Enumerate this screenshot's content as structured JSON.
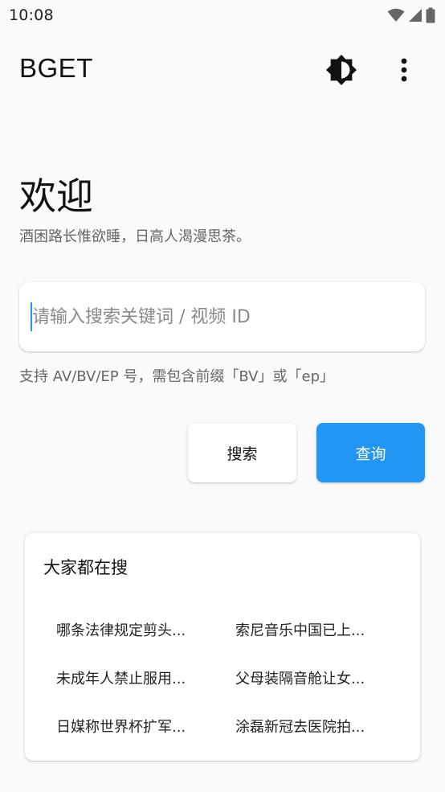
{
  "status_bar": {
    "time": "10:08"
  },
  "app_bar": {
    "title": "BGET"
  },
  "welcome": {
    "title": "欢迎",
    "subtitle": "酒困路长惟欲睡，日高人渴漫思茶。"
  },
  "search": {
    "placeholder": "请输入搜索关键词 / 视频 ID",
    "value": "",
    "helper": "支持 AV/BV/EP 号，需包含前缀「BV」或「ep」"
  },
  "buttons": {
    "search_label": "搜索",
    "query_label": "查询"
  },
  "trending": {
    "title": "大家都在搜",
    "items": [
      {
        "label": "哪条法律规定剪头..."
      },
      {
        "label": "索尼音乐中国已上..."
      },
      {
        "label": "未成年人禁止服用..."
      },
      {
        "label": "父母装隔音舱让女..."
      },
      {
        "label": "日媒称世界杯扩军..."
      },
      {
        "label": "涂磊新冠去医院拍..."
      }
    ]
  },
  "colors": {
    "accent": "#2196f3",
    "background": "#fafafa",
    "card": "#ffffff"
  },
  "icons": {
    "wifi": "wifi-icon",
    "signal": "signal-icon",
    "battery": "battery-icon",
    "theme": "brightness-icon",
    "more": "more-vert-icon"
  }
}
